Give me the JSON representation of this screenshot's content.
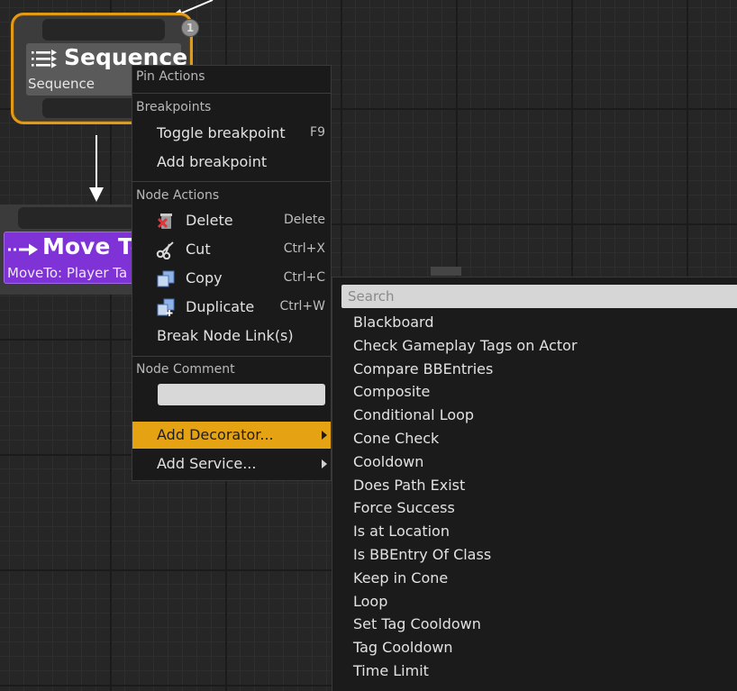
{
  "graph": {
    "sequence_node": {
      "title": "Sequence",
      "subtitle": "Sequence",
      "execution_index": "1"
    },
    "move_to_node": {
      "title": "Move To",
      "subtitle": "MoveTo: Player Ta"
    }
  },
  "context_menu": {
    "pin_actions_heading": "Pin Actions",
    "breakpoints_heading": "Breakpoints",
    "toggle_breakpoint": {
      "label": "Toggle breakpoint",
      "shortcut": "F9"
    },
    "add_breakpoint": {
      "label": "Add breakpoint"
    },
    "node_actions_heading": "Node Actions",
    "delete": {
      "label": "Delete",
      "shortcut": "Delete",
      "icon": "delete-icon"
    },
    "cut": {
      "label": "Cut",
      "shortcut": "Ctrl+X",
      "icon": "scissors-icon"
    },
    "copy": {
      "label": "Copy",
      "shortcut": "Ctrl+C",
      "icon": "copy-icon"
    },
    "duplicate": {
      "label": "Duplicate",
      "shortcut": "Ctrl+W",
      "icon": "duplicate-icon"
    },
    "break_links": {
      "label": "Break Node Link(s)"
    },
    "node_comment_heading": "Node Comment",
    "comment_value": "",
    "add_decorator": {
      "label": "Add Decorator...",
      "highlighted": true
    },
    "add_service": {
      "label": "Add Service..."
    }
  },
  "decorator_menu": {
    "search_placeholder": "Search",
    "items": [
      "Blackboard",
      "Check Gameplay Tags on Actor",
      "Compare BBEntries",
      "Composite",
      "Conditional Loop",
      "Cone Check",
      "Cooldown",
      "Does Path Exist",
      "Force Success",
      "Is at Location",
      "Is BBEntry Of Class",
      "Keep in Cone",
      "Loop",
      "Set Tag Cooldown",
      "Tag Cooldown",
      "Time Limit"
    ]
  },
  "colors": {
    "graph_background": "#262626",
    "selection_outline": "#e39a17",
    "menu_highlight": "#e5a212",
    "move_to_node": "#7f33d6"
  }
}
